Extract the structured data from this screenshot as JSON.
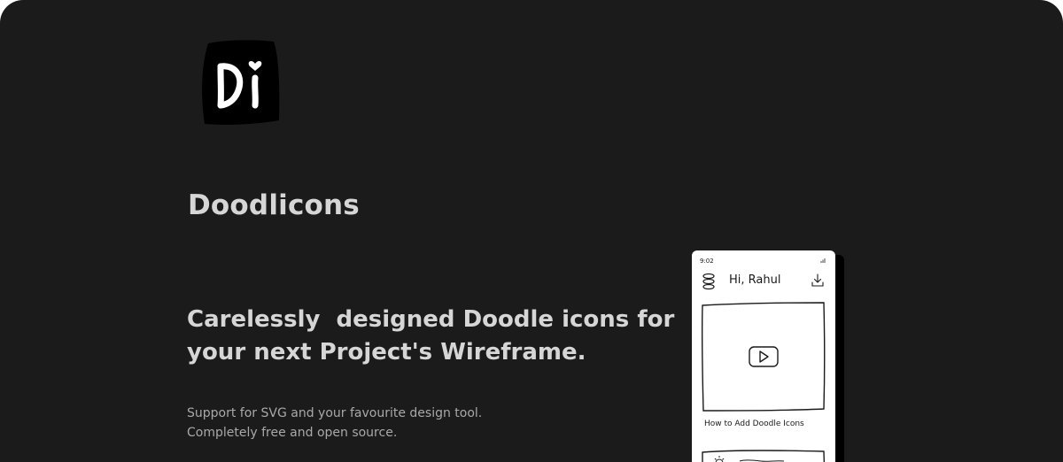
{
  "colors": {
    "background": "#1c1b1b",
    "heading": "#d6d6d6",
    "body_text": "#a9a9a9",
    "phone_screen": "#ffffff",
    "logo_fill": "#000000"
  },
  "brand": {
    "logo_text": "Di",
    "name": "Doodlicons"
  },
  "hero": {
    "tagline_line1": "Carelessly  designed Doodle icons for",
    "tagline_line2": "your next Project's Wireframe.",
    "description_line1": "Support for SVG and your favourite design tool.",
    "description_line2": "Completely free and open source."
  },
  "phone": {
    "status_time": "9:02",
    "greeting": "Hi, Rahul",
    "menu_icon": "stack-menu-icon",
    "download_icon": "download-icon",
    "play_icon": "play-icon",
    "card_title": "How to Add Doodle Icons"
  }
}
